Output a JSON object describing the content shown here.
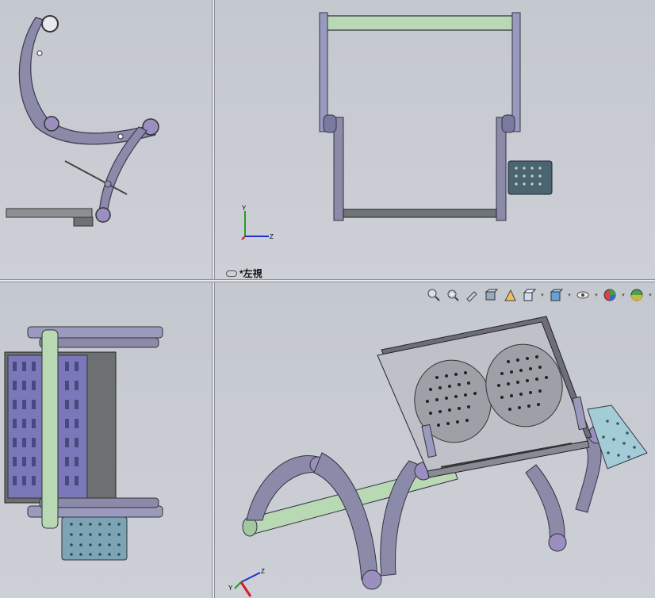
{
  "active_view_label": "*左視",
  "triad": {
    "x": "X",
    "y": "Y",
    "z": "Z"
  },
  "toolbar_icons": [
    "zoom-to-fit-icon",
    "zoom-to-area-icon",
    "previous-view-icon",
    "section-view-icon",
    "dynamic-annotation-view-icon",
    "view-orientation-icon",
    "display-style-icon",
    "hide-show-items-icon",
    "edit-appearance-icon",
    "apply-scene-icon"
  ],
  "colors": {
    "background": "#c8cbd2",
    "part_purple": "#8a8aaa",
    "rod_green": "#b8d8b0",
    "pedal_teal": "#6e8fa0",
    "axis_x": "#d02020",
    "axis_y": "#20a020",
    "axis_z": "#2030d0"
  }
}
